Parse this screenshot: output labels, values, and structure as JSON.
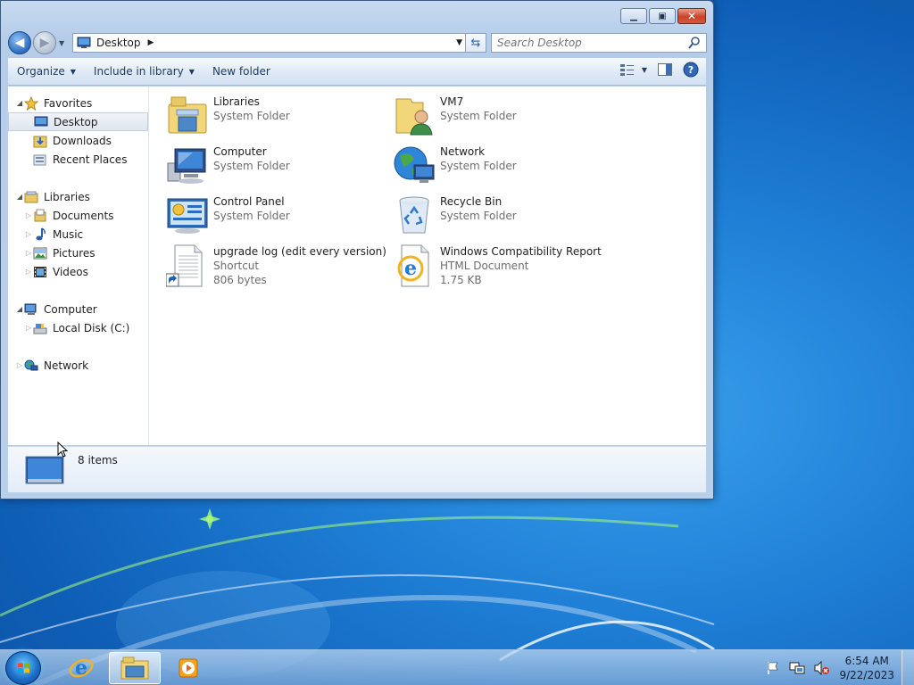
{
  "window": {
    "address": {
      "location": "Desktop"
    },
    "search": {
      "placeholder": "Search Desktop"
    },
    "toolbar": {
      "organize": "Organize",
      "include_in_library": "Include in library",
      "new_folder": "New folder"
    },
    "nav": {
      "favorites": "Favorites",
      "desktop": "Desktop",
      "downloads": "Downloads",
      "recent_places": "Recent Places",
      "libraries": "Libraries",
      "documents": "Documents",
      "music": "Music",
      "pictures": "Pictures",
      "videos": "Videos",
      "computer": "Computer",
      "local_disk": "Local Disk (C:)",
      "network": "Network"
    },
    "files": [
      {
        "name": "Libraries",
        "type": "System Folder",
        "size": ""
      },
      {
        "name": "VM7",
        "type": "System Folder",
        "size": ""
      },
      {
        "name": "Computer",
        "type": "System Folder",
        "size": ""
      },
      {
        "name": "Network",
        "type": "System Folder",
        "size": ""
      },
      {
        "name": "Control Panel",
        "type": "System Folder",
        "size": ""
      },
      {
        "name": "Recycle Bin",
        "type": "System Folder",
        "size": ""
      },
      {
        "name": "upgrade log (edit every version)",
        "type": "Shortcut",
        "size": "806 bytes"
      },
      {
        "name": "Windows Compatibility Report",
        "type": "HTML Document",
        "size": "1.75 KB"
      }
    ],
    "status": {
      "item_count": "8 items"
    }
  },
  "taskbar": {
    "clock_time": "6:54 AM",
    "clock_date": "9/22/2023"
  },
  "colors": {
    "accent": "#2a6cc2",
    "selection": "#dfe6ee",
    "close_button": "#c9432a"
  }
}
